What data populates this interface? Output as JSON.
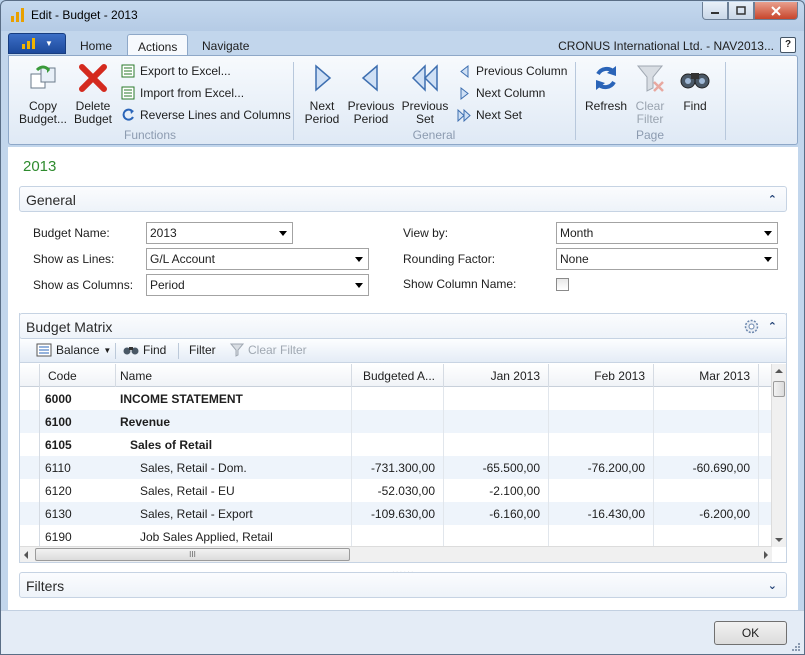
{
  "window": {
    "title": "Edit - Budget - 2013"
  },
  "tabs": [
    "Home",
    "Actions",
    "Navigate"
  ],
  "active_tab": "Actions",
  "company": "CRONUS International Ltd. - NAV2013...",
  "ribbon": {
    "functions": {
      "label": "Functions",
      "copy_budget": [
        "Copy",
        "Budget..."
      ],
      "delete_budget": [
        "Delete",
        "Budget"
      ],
      "export_excel": "Export to Excel...",
      "import_excel": "Import from Excel...",
      "reverse": "Reverse Lines and Columns"
    },
    "general": {
      "label": "General",
      "next_period": [
        "Next",
        "Period"
      ],
      "previous_period": [
        "Previous",
        "Period"
      ],
      "previous_set": [
        "Previous",
        "Set"
      ],
      "previous_column": "Previous Column",
      "next_column": "Next Column",
      "next_set": "Next Set"
    },
    "page": {
      "label": "Page",
      "refresh": "Refresh",
      "clear_filter": [
        "Clear",
        "Filter"
      ],
      "find": "Find"
    }
  },
  "page_title": "2013",
  "general_tab": {
    "title": "General",
    "budget_name_label": "Budget Name:",
    "budget_name": "2013",
    "show_as_lines_label": "Show as Lines:",
    "show_as_lines": "G/L Account",
    "show_as_columns_label": "Show as Columns:",
    "show_as_columns": "Period",
    "view_by_label": "View by:",
    "view_by": "Month",
    "rounding_label": "Rounding Factor:",
    "rounding": "None",
    "show_col_name_label": "Show Column Name:",
    "show_col_name": false
  },
  "matrix": {
    "title": "Budget Matrix",
    "toolbar": {
      "balance": "Balance",
      "find": "Find",
      "filter": "Filter",
      "clear_filter": "Clear Filter"
    },
    "columns": [
      "Code",
      "Name",
      "Budgeted A...",
      "Jan 2013",
      "Feb 2013",
      "Mar 2013"
    ],
    "rows": [
      {
        "code": "6000",
        "name": "INCOME STATEMENT",
        "indent": 0,
        "bold": true,
        "values": [
          "",
          "",
          "",
          ""
        ]
      },
      {
        "code": "6100",
        "name": "Revenue",
        "indent": 0,
        "bold": true,
        "values": [
          "",
          "",
          "",
          ""
        ]
      },
      {
        "code": "6105",
        "name": "Sales of Retail",
        "indent": 1,
        "bold": true,
        "values": [
          "",
          "",
          "",
          ""
        ]
      },
      {
        "code": "6110",
        "name": "Sales, Retail - Dom.",
        "indent": 2,
        "bold": false,
        "values": [
          "-731.300,00",
          "-65.500,00",
          "-76.200,00",
          "-60.690,00"
        ]
      },
      {
        "code": "6120",
        "name": "Sales, Retail - EU",
        "indent": 2,
        "bold": false,
        "values": [
          "-52.030,00",
          "-2.100,00",
          "",
          ""
        ]
      },
      {
        "code": "6130",
        "name": "Sales, Retail - Export",
        "indent": 2,
        "bold": false,
        "values": [
          "-109.630,00",
          "-6.160,00",
          "-16.430,00",
          "-6.200,00"
        ]
      },
      {
        "code": "6190",
        "name": "Job Sales Applied, Retail",
        "indent": 2,
        "bold": false,
        "values": [
          "",
          "",
          "",
          ""
        ]
      }
    ],
    "hscroll_grip": "III"
  },
  "filters_tab": {
    "title": "Filters"
  },
  "ok_label": "OK",
  "splitter": "......",
  "colors": {
    "accent_green": "#2e8b2e",
    "ribbon_label": "#8c9bb0",
    "app_button": "#2a5bb5"
  }
}
